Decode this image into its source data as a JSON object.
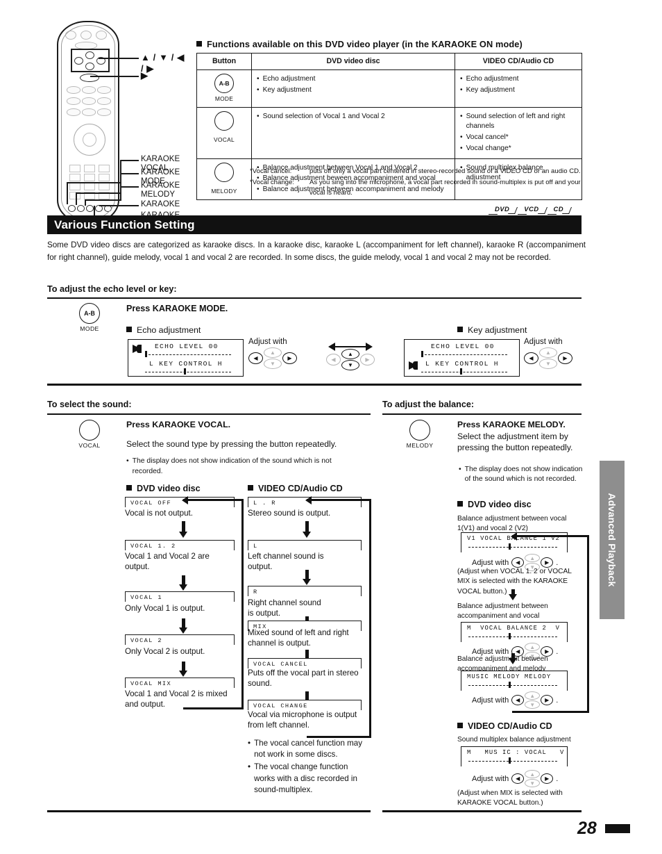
{
  "remote": {
    "callouts": [
      {
        "text": "▲ / ▼ / ◀ / ▶",
        "glyph": true
      },
      {
        "text": "▶",
        "glyph": true
      },
      {
        "text": "KARAOKE\nVOCAL"
      },
      {
        "text": "KARAOKE\nMODE"
      },
      {
        "text": "KARAOKE\nMELODY"
      },
      {
        "text": "KARAOKE"
      },
      {
        "text": "KARAOKE\nON/OFF"
      }
    ]
  },
  "functions": {
    "heading": "Functions available on this DVD video player (in the KARAOKE ON mode)",
    "columns": [
      "Button",
      "DVD video disc",
      "VIDEO CD/Audio CD"
    ],
    "rows": [
      {
        "button_label": "A-B",
        "button_caption": "MODE",
        "dvd": [
          "Echo adjustment",
          "Key adjustment"
        ],
        "cd": [
          "Echo adjustment",
          "Key adjustment"
        ]
      },
      {
        "button_label": "",
        "button_caption": "VOCAL",
        "dvd": [
          "Sound selection of Vocal 1 and Vocal 2"
        ],
        "cd": [
          "Sound selection of left and right channels",
          "Vocal cancel*",
          "Vocal change*"
        ]
      },
      {
        "button_label": "",
        "button_caption": "MELODY",
        "dvd": [
          "Balance adjustment between Vocal 1 and Vocal 2",
          "Balance adjustment beween accompaniment and vocal",
          "Balance adjustment between accompaniment and melody"
        ],
        "cd": [
          "Sound multiplex balance adjustment"
        ]
      }
    ],
    "footnotes": [
      {
        "key": "*Vocal cancel:",
        "value": "puts off only a vocal part centered in stereo-recorded sound of a VIDEO CD or an audio CD."
      },
      {
        "key": "*Vocal change:",
        "value": "As you sing into the microphone, a vocal part recorded in sound-multiplex is put off and your vocal is heard."
      }
    ]
  },
  "disc_badges": [
    "DVD",
    "VCD",
    "CD"
  ],
  "section": {
    "title": "Various Function Setting",
    "intro": "Some DVD video discs are categorized as karaoke discs. In a karaoke disc, karaoke L (accompaniment for left channel), karaoke R (accompaniment for right channel), guide melody, vocal 1 and vocal 2 are recorded. In some discs, the guide melody, vocal 1 and vocal 2 may not be recorded."
  },
  "echo_section": {
    "heading": "To adjust the echo level or key:",
    "button_label": "A-B",
    "button_caption": "MODE",
    "press": "Press KARAOKE MODE.",
    "echo_sub": "Echo adjustment",
    "key_sub": "Key adjustment",
    "adjust_with": "Adjust with",
    "display": {
      "line1": "ECHO LEVEL 00",
      "line2": "L KEY CONTROL H"
    }
  },
  "sound_section": {
    "heading": "To select the sound:",
    "button_caption": "VOCAL",
    "press": "Press KARAOKE VOCAL.",
    "desc": "Select the sound type by pressing the button repeatedly.",
    "note": "The display does not show indication of the sound which is not recorded.",
    "dvd_heading": "DVD video disc",
    "cd_heading": "VIDEO CD/Audio CD",
    "dvd_steps": [
      {
        "code": "VOCAL OFF",
        "desc": "Vocal is not output."
      },
      {
        "code": "VOCAL 1. 2",
        "desc": "Vocal 1 and Vocal 2 are output."
      },
      {
        "code": "VOCAL 1",
        "desc": "Only Vocal 1 is output."
      },
      {
        "code": "VOCAL 2",
        "desc": "Only Vocal 2 is output."
      },
      {
        "code": "VOCAL MIX",
        "desc": "Vocal 1 and Vocal 2 is mixed and output."
      }
    ],
    "cd_steps": [
      {
        "code": "L . R",
        "desc": "Stereo sound is output."
      },
      {
        "code": "L",
        "desc": "Left channel sound is output."
      },
      {
        "code": "R",
        "desc": "Right channel sound is output."
      },
      {
        "code": "MIX",
        "desc": "Mixed sound of left and right channel is output."
      },
      {
        "code": "VOCAL CANCEL",
        "desc": "Puts off the vocal part in stereo sound."
      },
      {
        "code": "VOCAL CHANGE",
        "desc": "Vocal via microphone is output from left channel."
      }
    ],
    "cd_notes": [
      "The vocal cancel function may not work in some discs.",
      "The vocal change function works with a disc recorded in sound-multiplex."
    ]
  },
  "balance_section": {
    "heading": "To adjust the balance:",
    "button_caption": "MELODY",
    "press": "Press KARAOKE MELODY.",
    "desc": "Select the adjustment item by pressing the button repeatedly.",
    "note": "The display does not show indication of the sound which is not recorded.",
    "dvd_heading": "DVD video disc",
    "cd_heading": "VIDEO CD/Audio CD",
    "adjust_with": "Adjust with",
    "dvd_items": [
      {
        "caption": "Balance adjustment between vocal 1(V1) and vocal 2 (V2)",
        "code": "V1 VOCAL BALANCE 1 V2",
        "note": "(Adjust when VOCAL 1. 2 or VOCAL MIX is selected with the KARAOKE VOCAL button.)"
      },
      {
        "caption": "Balance adjustment between accompaniment and vocal",
        "code": "M  VOCAL BALANCE 2  V",
        "note": ""
      },
      {
        "caption": "Balance adjustment between accompaniment and melody",
        "code": "MUSIC MELODY MELODY",
        "note": ""
      }
    ],
    "cd_item": {
      "caption": "Sound multiplex balance adjustment",
      "code": "M   MUS IC : VOCAL   V",
      "note": "(Adjust when MIX is selected with KARAOKE VOCAL button.)"
    }
  },
  "side_tab": "Advanced Playback",
  "page_number": "28"
}
